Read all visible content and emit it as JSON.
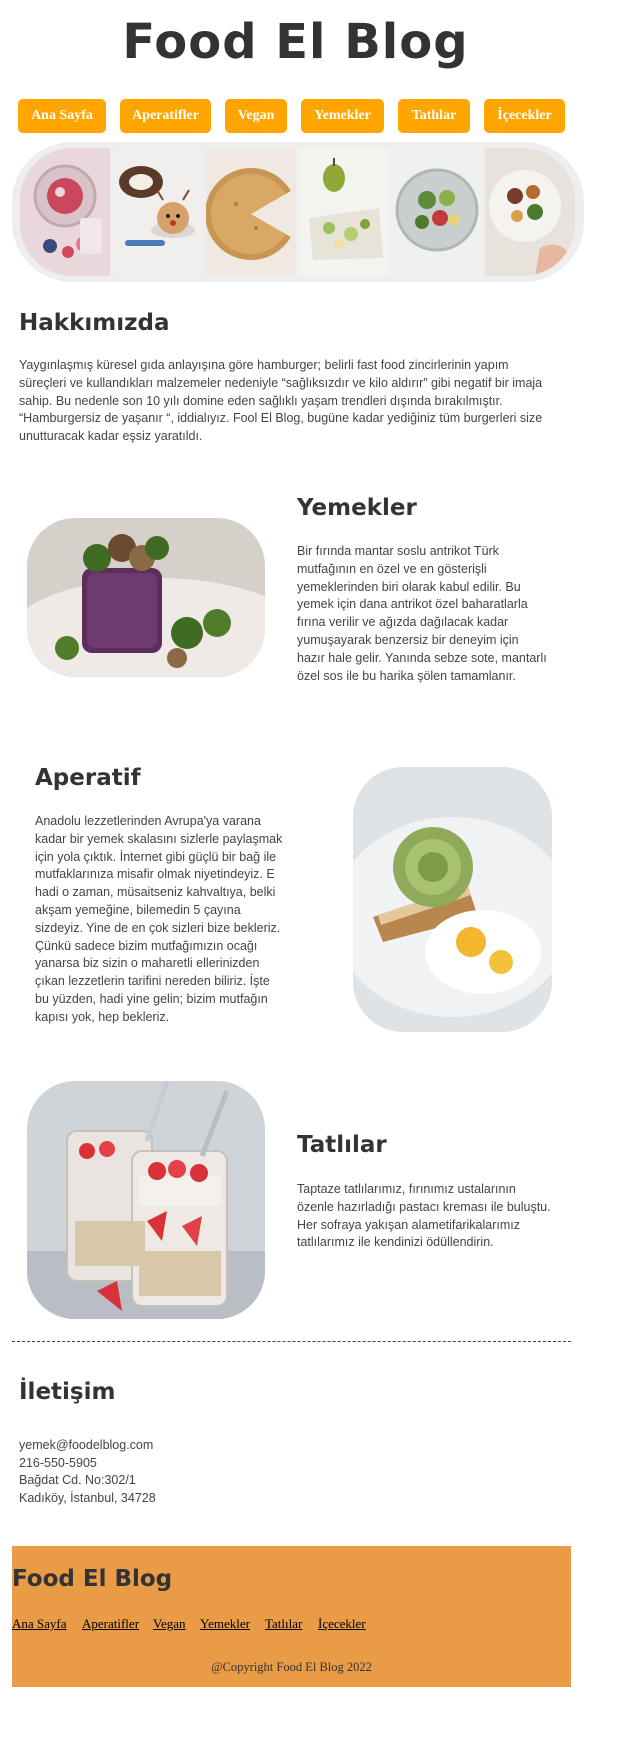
{
  "site": {
    "title": "Food El Blog"
  },
  "nav": {
    "items": [
      {
        "label": "Ana Sayfa"
      },
      {
        "label": "Aperatifler"
      },
      {
        "label": "Vegan"
      },
      {
        "label": "Yemekler"
      },
      {
        "label": "Tatlılar"
      },
      {
        "label": "İçecekler"
      }
    ],
    "accent": "#ffa500"
  },
  "about": {
    "heading": "Hakkımızda",
    "text": "Yaygınlaşmış küresel gıda anlayışına göre hamburger; belirli fast food zincirlerinin yapım süreçleri ve kullandıkları malzemeler nedeniyle “sağlıksızdır ve kilo aldırır” gibi negatif bir imaja sahip. Bu nedenle son 10 yılı domine eden sağlıklı yaşam trendleri dışında bırakılmıştır. “Hamburgersiz de yaşanır “, iddialıyız. Fool El Blog, bugüne kadar yediğiniz tüm burgerleri size unutturacak kadar eşsiz yaratıldı."
  },
  "yemekler": {
    "heading": "Yemekler",
    "text": "Bir fırında mantar soslu antrikot Türk mutfağının en özel ve en gösterişli yemeklerinden biri olarak kabul edilir. Bu yemek için dana antrikot özel baharatlarla fırına verilir ve ağızda dağılacak kadar yumuşayarak benzersiz bir deneyim için hazır hale gelir. Yanında sebze sote, mantarlı özel sos ile bu harika şölen tamamlanır."
  },
  "aperatif": {
    "heading": "Aperatif",
    "text": "Anadolu lezzetlerinden Avrupa'ya varana kadar bir yemek skalasını sizlerle paylaşmak için yola çıktık. İnternet gibi güçlü bir bağ ile mutfaklarınıza misafir olmak niyetindeyiz. E hadi o zaman, müsaitseniz kahvaltıya, belki akşam yemeğine, bilemedin 5 çayına sizdeyiz. Yine de en çok sizleri bize bekleriz. Çünkü sadece bizim mutfağımızın ocağı yanarsa biz sizin o maharetli ellerinizden çıkan lezzetlerin tarifini nereden biliriz. İşte bu yüzden, hadi yine gelin; bizim mutfağın kapısı yok, hep bekleriz."
  },
  "tatlilar": {
    "heading": "Tatlılar",
    "text": "Taptaze tatlılarımız, fırınımız ustalarının özenle hazırladığı pastacı kreması ile buluştu. Her sofraya yakışan alametifarikalarımız tatlılarımız ile kendinizi ödüllendirin."
  },
  "contact": {
    "heading": "İletişim",
    "email": "yemek@foodelblog.com",
    "phone": "216-550-5905",
    "address_line1": "Bağdat Cd. No:302/1",
    "address_line2": "Kadıköy, İstanbul, 34728"
  },
  "footer": {
    "title": "Food El Blog",
    "links": [
      {
        "label": "Ana Sayfa"
      },
      {
        "label": "Aperatifler"
      },
      {
        "label": "Vegan"
      },
      {
        "label": "Yemekler"
      },
      {
        "label": "Tatlılar"
      },
      {
        "label": "İçecekler"
      }
    ],
    "copyright": "@Copyright Food El Blog 2022",
    "background": "#e99b46"
  }
}
